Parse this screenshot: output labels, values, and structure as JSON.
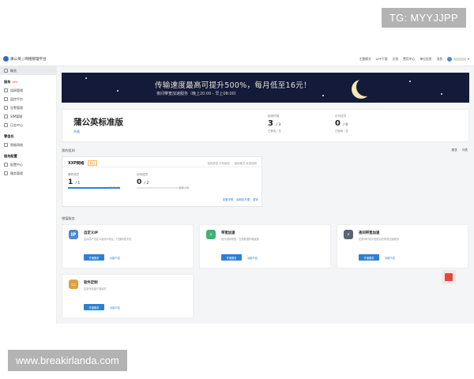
{
  "watermarks": {
    "top": "TG: MYYJJPP",
    "bottom": "www.breakirlanda.com"
  },
  "topbar": {
    "brand": "蒲公英 | 网络管理平台",
    "nav": [
      "主题模式",
      "APP下载",
      "文档",
      "费用中心",
      "单位信息",
      "消息"
    ]
  },
  "sidebar": {
    "home": "概览",
    "groups": [
      {
        "title": "服务",
        "badge": "NEW",
        "items": [
          "组网管理",
          "监控平台",
          "告警管理",
          "SIM管理",
          "日志中心"
        ]
      },
      {
        "title": "零信任",
        "items": [
          "智能网络"
        ]
      },
      {
        "title": "服务配置",
        "items": [
          "配置中心",
          "服务管理"
        ]
      }
    ]
  },
  "banner": {
    "headline": "传输速度最高可提升500%，每月低至16元！",
    "sub": "夜间带宽加速服务（晚上20:00 - 早上08:00）"
  },
  "plan": {
    "name": "蒲公英标准版",
    "upgrade": "升级",
    "stats": [
      {
        "label": "组网终端",
        "value": "3",
        "total": "/ 3",
        "sub": "已使用 / 总"
      },
      {
        "label": "访问成员",
        "value": "0",
        "total": "/ 0",
        "sub": "已使用 / 总"
      }
    ]
  },
  "network_section": {
    "title": "我的组网",
    "toggles": [
      "图表",
      "列表"
    ]
  },
  "network_card": {
    "name": "XXP网络",
    "tag": "默认",
    "meta": [
      "组网类型 分布组网",
      "组网模式 标准组网"
    ],
    "stats": [
      {
        "label": "硬件成员",
        "value": "1",
        "total": "/ 1",
        "side": "在线 / 总",
        "fill": 1.0
      },
      {
        "label": "访问成员",
        "value": "0",
        "total": "/ 2",
        "side": "在线 / 总",
        "fill": 0.0
      }
    ],
    "links": [
      "查看详情",
      "组网拓扑图",
      "更多"
    ]
  },
  "services": {
    "title": "增值服务",
    "items": [
      {
        "icon": "ip-icon",
        "glyph": "IP",
        "color": "#4a8bd6",
        "title": "自定义IP",
        "desc": "支持用户自定义组网IP地址，打通网段冲突",
        "button": "开通服务",
        "link": "功能介绍"
      },
      {
        "icon": "lightning-icon",
        "glyph": "⚡",
        "color": "#3cb371",
        "title": "带宽加速",
        "desc": "提升组网带宽，加快数据传输速度",
        "button": "开通服务",
        "link": "功能介绍"
      },
      {
        "icon": "boost-icon",
        "glyph": "⚡",
        "color": "#5a6474",
        "title": "夜间带宽加速",
        "desc": "在夜间时段享受更高的带宽加速服务",
        "button": "开通服务",
        "link": "功能介绍"
      },
      {
        "icon": "software-icon",
        "glyph": "▭",
        "color": "#e0a040",
        "title": "软件定制",
        "desc": "定制专属客户端软件",
        "button": "开通服务",
        "link": "功能介绍"
      }
    ]
  }
}
